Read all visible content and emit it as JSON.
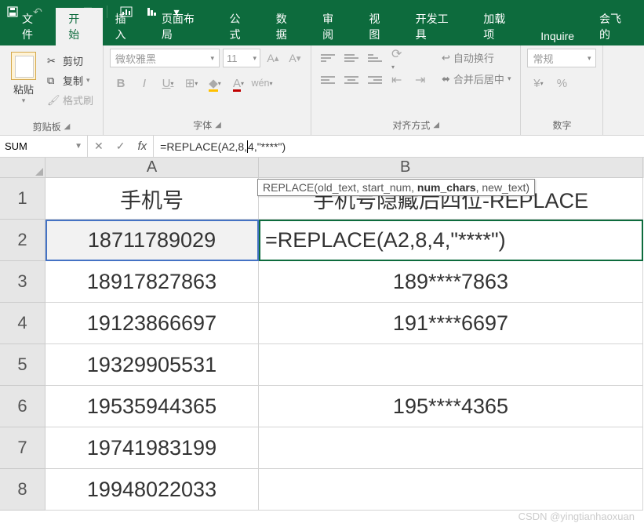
{
  "titlebar": {
    "icons": [
      "save-icon",
      "undo-icon",
      "redo-icon",
      "new-icon",
      "chart-icon",
      "sort-icon"
    ]
  },
  "tabs": {
    "items": [
      "文件",
      "开始",
      "插入",
      "页面布局",
      "公式",
      "数据",
      "审阅",
      "视图",
      "开发工具",
      "加载项",
      "Inquire",
      "会飞的"
    ],
    "active": 1
  },
  "ribbon": {
    "clipboard": {
      "paste": "粘贴",
      "cut": "剪切",
      "copy": "复制",
      "format_painter": "格式刷",
      "label": "剪贴板"
    },
    "font": {
      "name": "微软雅黑",
      "size": "11",
      "label": "字体"
    },
    "alignment": {
      "wrap": "自动换行",
      "merge": "合并后居中",
      "label": "对齐方式"
    },
    "number": {
      "format": "常规",
      "label": "数字"
    }
  },
  "formula_bar": {
    "name_box": "SUM",
    "formula_pre": "=REPLACE(A2,8,",
    "formula_post": "4,\"****\")"
  },
  "tooltip": {
    "func": "REPLACE",
    "arg1": "old_text",
    "arg2": "start_num",
    "arg3": "num_chars",
    "arg4": "new_text"
  },
  "grid": {
    "columns": [
      "A",
      "B"
    ],
    "rows": [
      {
        "num": "1",
        "a": "手机号",
        "b": "手机号隐藏后四位-REPLACE"
      },
      {
        "num": "2",
        "a": "18711789029",
        "b": "=REPLACE(A2,8,4,\"****\")"
      },
      {
        "num": "3",
        "a": "18917827863",
        "b": "189****7863"
      },
      {
        "num": "4",
        "a": "19123866697",
        "b": "191****6697"
      },
      {
        "num": "5",
        "a": "19329905531",
        "b": ""
      },
      {
        "num": "6",
        "a": "19535944365",
        "b": "195****4365"
      },
      {
        "num": "7",
        "a": "19741983199",
        "b": ""
      },
      {
        "num": "8",
        "a": "19948022033",
        "b": ""
      }
    ]
  },
  "watermark": "CSDN @yingtianhaoxuan"
}
